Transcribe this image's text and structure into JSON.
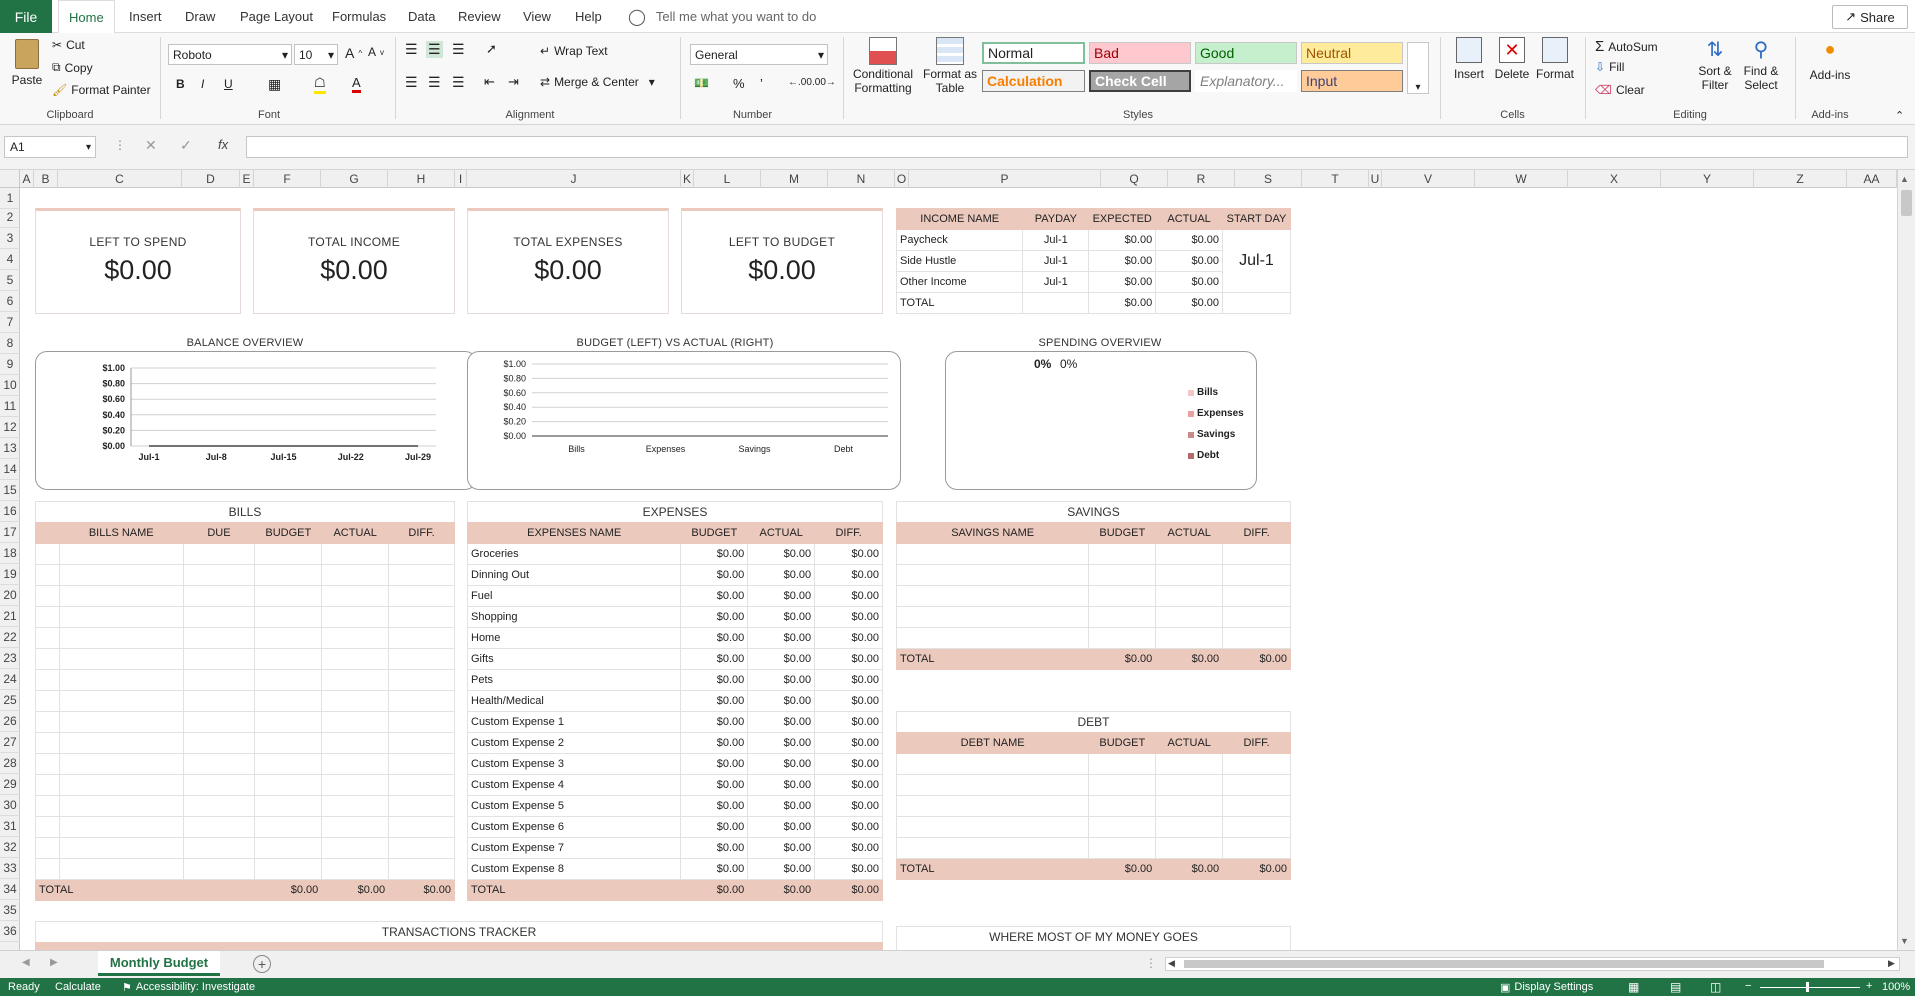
{
  "tabs": {
    "file": "File",
    "items": [
      "Home",
      "Insert",
      "Draw",
      "Page Layout",
      "Formulas",
      "Data",
      "Review",
      "View",
      "Help"
    ],
    "tellme": "Tell me what you want to do",
    "share": "Share"
  },
  "ribbon": {
    "clipboard": {
      "label": "Clipboard",
      "paste": "Paste",
      "cut": "Cut",
      "copy": "Copy",
      "format_painter": "Format Painter"
    },
    "font": {
      "label": "Font",
      "name": "Roboto",
      "size": "10"
    },
    "alignment": {
      "label": "Alignment",
      "wrap": "Wrap Text",
      "merge": "Merge & Center"
    },
    "number": {
      "label": "Number",
      "format": "General"
    },
    "styles": {
      "label": "Styles",
      "conditional": "Conditional Formatting",
      "format_table": "Format as Table",
      "normal": "Normal",
      "bad": "Bad",
      "good": "Good",
      "neutral": "Neutral",
      "calculation": "Calculation",
      "check_cell": "Check Cell",
      "explanatory": "Explanatory...",
      "input": "Input"
    },
    "cells": {
      "label": "Cells",
      "insert": "Insert",
      "delete": "Delete",
      "format": "Format"
    },
    "editing": {
      "label": "Editing",
      "autosum": "AutoSum",
      "fill": "Fill",
      "clear": "Clear",
      "sort": "Sort & Filter",
      "find": "Find & Select"
    },
    "addins": {
      "label": "Add-ins",
      "button": "Add-ins"
    }
  },
  "formula_bar": {
    "name_box": "A1",
    "value": ""
  },
  "columns": [
    "A",
    "B",
    "C",
    "D",
    "E",
    "F",
    "G",
    "H",
    "I",
    "J",
    "K",
    "L",
    "M",
    "N",
    "O",
    "P",
    "Q",
    "R",
    "S",
    "T",
    "U",
    "V",
    "W",
    "X",
    "Y",
    "Z",
    "AA"
  ],
  "rows": [
    "1",
    "2",
    "3",
    "4",
    "5",
    "6",
    "7",
    "8",
    "9",
    "10",
    "11",
    "12",
    "13",
    "14",
    "15",
    "16",
    "17",
    "18",
    "19",
    "20",
    "21",
    "22",
    "23",
    "24",
    "25",
    "26",
    "27",
    "28",
    "29",
    "30",
    "31",
    "32",
    "33",
    "34",
    "35",
    "36"
  ],
  "kpis": [
    {
      "label": "LEFT TO SPEND",
      "value": "$0.00"
    },
    {
      "label": "TOTAL INCOME",
      "value": "$0.00"
    },
    {
      "label": "TOTAL EXPENSES",
      "value": "$0.00"
    },
    {
      "label": "LEFT TO BUDGET",
      "value": "$0.00"
    }
  ],
  "income": {
    "headers": [
      "INCOME NAME",
      "PAYDAY",
      "EXPECTED",
      "ACTUAL",
      "START DAY"
    ],
    "rows": [
      [
        "Paycheck",
        "Jul-1",
        "$0.00",
        "$0.00"
      ],
      [
        "Side Hustle",
        "Jul-1",
        "$0.00",
        "$0.00"
      ],
      [
        "Other Income",
        "Jul-1",
        "$0.00",
        "$0.00"
      ],
      [
        "TOTAL",
        "",
        "$0.00",
        "$0.00"
      ]
    ],
    "start_day": "Jul-1"
  },
  "charts": {
    "balance": {
      "title": "BALANCE OVERVIEW"
    },
    "budget_actual": {
      "title": "BUDGET (LEFT) VS ACTUAL (RIGHT)"
    },
    "spending": {
      "title": "SPENDING OVERVIEW",
      "pct1": "0%",
      "pct2": "0%"
    }
  },
  "chart_data": [
    {
      "type": "line",
      "title": "BALANCE OVERVIEW",
      "x": [
        "Jul-1",
        "Jul-8",
        "Jul-15",
        "Jul-22",
        "Jul-29"
      ],
      "y_ticks": [
        "$1.00",
        "$0.80",
        "$0.60",
        "$0.40",
        "$0.20",
        "$0.00"
      ],
      "ylim": [
        0,
        1
      ],
      "grid": true,
      "series": [
        {
          "values": [
            0,
            0,
            0,
            0,
            0
          ]
        }
      ]
    },
    {
      "type": "bar",
      "title": "BUDGET (LEFT) VS ACTUAL (RIGHT)",
      "categories": [
        "Bills",
        "Expenses",
        "Savings",
        "Debt"
      ],
      "y_ticks": [
        "$1.00",
        "$0.80",
        "$0.60",
        "$0.40",
        "$0.20",
        "$0.00"
      ],
      "ylim": [
        0,
        1
      ],
      "grid": true,
      "series": [
        {
          "values": [
            0,
            0,
            0,
            0
          ]
        },
        {
          "values": [
            0,
            0,
            0,
            0
          ]
        }
      ]
    },
    {
      "type": "pie",
      "title": "SPENDING OVERVIEW",
      "legend": [
        "Bills",
        "Expenses",
        "Savings",
        "Debt"
      ],
      "legend_colors": [
        "#f4c6c6",
        "#e8a0a0",
        "#c98a8a",
        "#b56a6a"
      ],
      "legend_placement": "right",
      "values": [
        0,
        0,
        0,
        0
      ]
    }
  ],
  "bills": {
    "title": "BILLS",
    "headers": [
      "BILLS NAME",
      "DUE",
      "BUDGET",
      "ACTUAL",
      "DIFF."
    ],
    "total": [
      "TOTAL",
      "",
      "$0.00",
      "$0.00",
      "$0.00"
    ]
  },
  "expenses": {
    "title": "EXPENSES",
    "headers": [
      "EXPENSES NAME",
      "BUDGET",
      "ACTUAL",
      "DIFF."
    ],
    "rows": [
      [
        "Groceries",
        "$0.00",
        "$0.00",
        "$0.00"
      ],
      [
        "Dinning Out",
        "$0.00",
        "$0.00",
        "$0.00"
      ],
      [
        "Fuel",
        "$0.00",
        "$0.00",
        "$0.00"
      ],
      [
        "Shopping",
        "$0.00",
        "$0.00",
        "$0.00"
      ],
      [
        "Home",
        "$0.00",
        "$0.00",
        "$0.00"
      ],
      [
        "Gifts",
        "$0.00",
        "$0.00",
        "$0.00"
      ],
      [
        "Pets",
        "$0.00",
        "$0.00",
        "$0.00"
      ],
      [
        "Health/Medical",
        "$0.00",
        "$0.00",
        "$0.00"
      ],
      [
        "Custom Expense 1",
        "$0.00",
        "$0.00",
        "$0.00"
      ],
      [
        "Custom Expense 2",
        "$0.00",
        "$0.00",
        "$0.00"
      ],
      [
        "Custom Expense 3",
        "$0.00",
        "$0.00",
        "$0.00"
      ],
      [
        "Custom Expense 4",
        "$0.00",
        "$0.00",
        "$0.00"
      ],
      [
        "Custom Expense 5",
        "$0.00",
        "$0.00",
        "$0.00"
      ],
      [
        "Custom Expense 6",
        "$0.00",
        "$0.00",
        "$0.00"
      ],
      [
        "Custom Expense 7",
        "$0.00",
        "$0.00",
        "$0.00"
      ],
      [
        "Custom Expense 8",
        "$0.00",
        "$0.00",
        "$0.00"
      ]
    ],
    "total": [
      "TOTAL",
      "$0.00",
      "$0.00",
      "$0.00"
    ]
  },
  "savings": {
    "title": "SAVINGS",
    "headers": [
      "SAVINGS NAME",
      "BUDGET",
      "ACTUAL",
      "DIFF."
    ],
    "total": [
      "TOTAL",
      "$0.00",
      "$0.00",
      "$0.00"
    ]
  },
  "debt": {
    "title": "DEBT",
    "headers": [
      "DEBT NAME",
      "BUDGET",
      "ACTUAL",
      "DIFF."
    ],
    "total": [
      "TOTAL",
      "$0.00",
      "$0.00",
      "$0.00"
    ]
  },
  "transactions": {
    "title": "TRANSACTIONS TRACKER"
  },
  "where_money": {
    "title": "WHERE MOST OF MY MONEY GOES"
  },
  "sheet": {
    "tab": "Monthly Budget"
  },
  "status": {
    "ready": "Ready",
    "calculate": "Calculate",
    "accessibility": "Accessibility: Investigate",
    "display": "Display Settings",
    "zoom": "100%"
  }
}
